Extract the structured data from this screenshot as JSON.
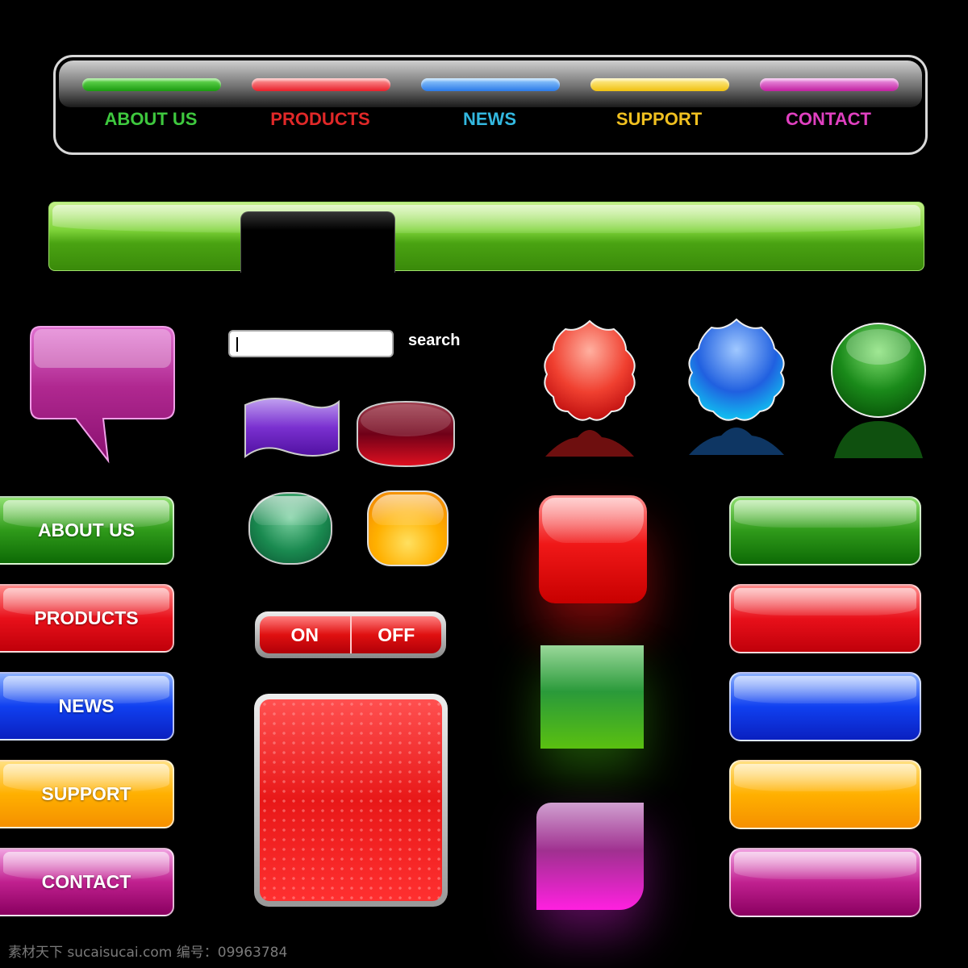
{
  "top_nav": {
    "items": [
      {
        "label": "ABOUT US",
        "color": "#3ec83e"
      },
      {
        "label": "PRODUCTS",
        "color": "#e02828"
      },
      {
        "label": "NEWS",
        "color": "#33b8e0"
      },
      {
        "label": "SUPPORT",
        "color": "#f0c020"
      },
      {
        "label": "CONTACT",
        "color": "#e040c0"
      }
    ]
  },
  "search": {
    "value": "",
    "label": "search"
  },
  "side_buttons": [
    {
      "label": "ABOUT US",
      "color": "green"
    },
    {
      "label": "PRODUCTS",
      "color": "red"
    },
    {
      "label": "NEWS",
      "color": "blue"
    },
    {
      "label": "SUPPORT",
      "color": "yellow"
    },
    {
      "label": "CONTACT",
      "color": "purple"
    }
  ],
  "toggle": {
    "on": "ON",
    "off": "OFF"
  },
  "watermark": "素材天下 sucaisucai.com  编号：09963784"
}
